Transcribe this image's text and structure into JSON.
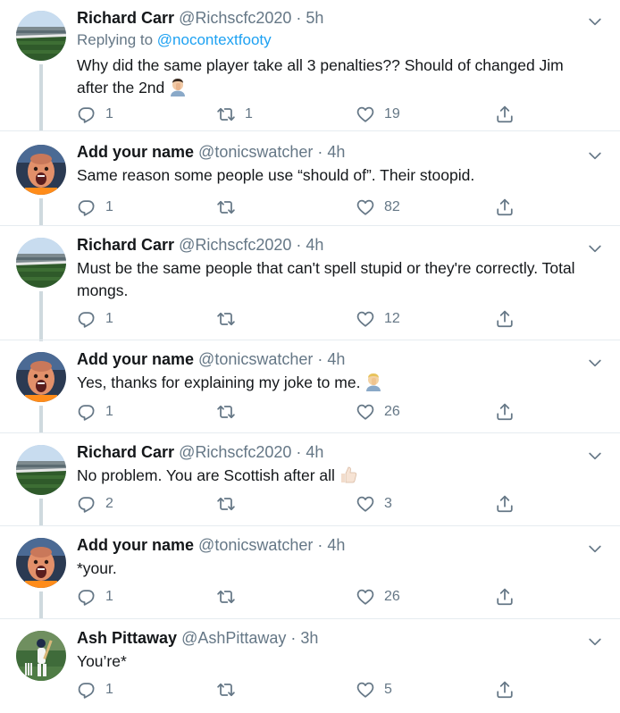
{
  "colors": {
    "accent": "#1da1f2",
    "muted": "#657786",
    "text": "#14171a",
    "thread": "#cfd9de"
  },
  "tweets": [
    {
      "name": "Richard Carr",
      "handle": "@Richscfc2020",
      "dot": "·",
      "time": "5h",
      "replying_prefix": "Replying to",
      "replying_to": "@nocontextfooty",
      "text": "Why did the same player take all 3 penalties?? Should of changed Jim after the 2nd",
      "emoji": "man-facepalming",
      "replies": "1",
      "retweets": "1",
      "likes": "19"
    },
    {
      "name": "Add your name",
      "handle": "@tonicswatcher",
      "dot": "·",
      "time": "4h",
      "text": "Same reason some people use “should of”. Their stoopid.",
      "replies": "1",
      "retweets": "",
      "likes": "82"
    },
    {
      "name": "Richard Carr",
      "handle": "@Richscfc2020",
      "dot": "·",
      "time": "4h",
      "text": "Must be the same people that can't spell stupid or they're correctly. Total mongs.",
      "replies": "1",
      "retweets": "",
      "likes": "12"
    },
    {
      "name": "Add your name",
      "handle": "@tonicswatcher",
      "dot": "·",
      "time": "4h",
      "text": "Yes, thanks for explaining my joke to me.",
      "emoji": "man-facepalming-blonde",
      "replies": "1",
      "retweets": "",
      "likes": "26"
    },
    {
      "name": "Richard Carr",
      "handle": "@Richscfc2020",
      "dot": "·",
      "time": "4h",
      "text": "No problem. You are Scottish after all",
      "emoji": "thumbs-up",
      "replies": "2",
      "retweets": "",
      "likes": "3"
    },
    {
      "name": "Add your name",
      "handle": "@tonicswatcher",
      "dot": "·",
      "time": "4h",
      "text": "*your.",
      "replies": "1",
      "retweets": "",
      "likes": "26"
    },
    {
      "name": "Ash Pittaway",
      "handle": "@AshPittaway",
      "dot": "·",
      "time": "3h",
      "text": "You’re*",
      "replies": "1",
      "retweets": "",
      "likes": "5"
    }
  ]
}
